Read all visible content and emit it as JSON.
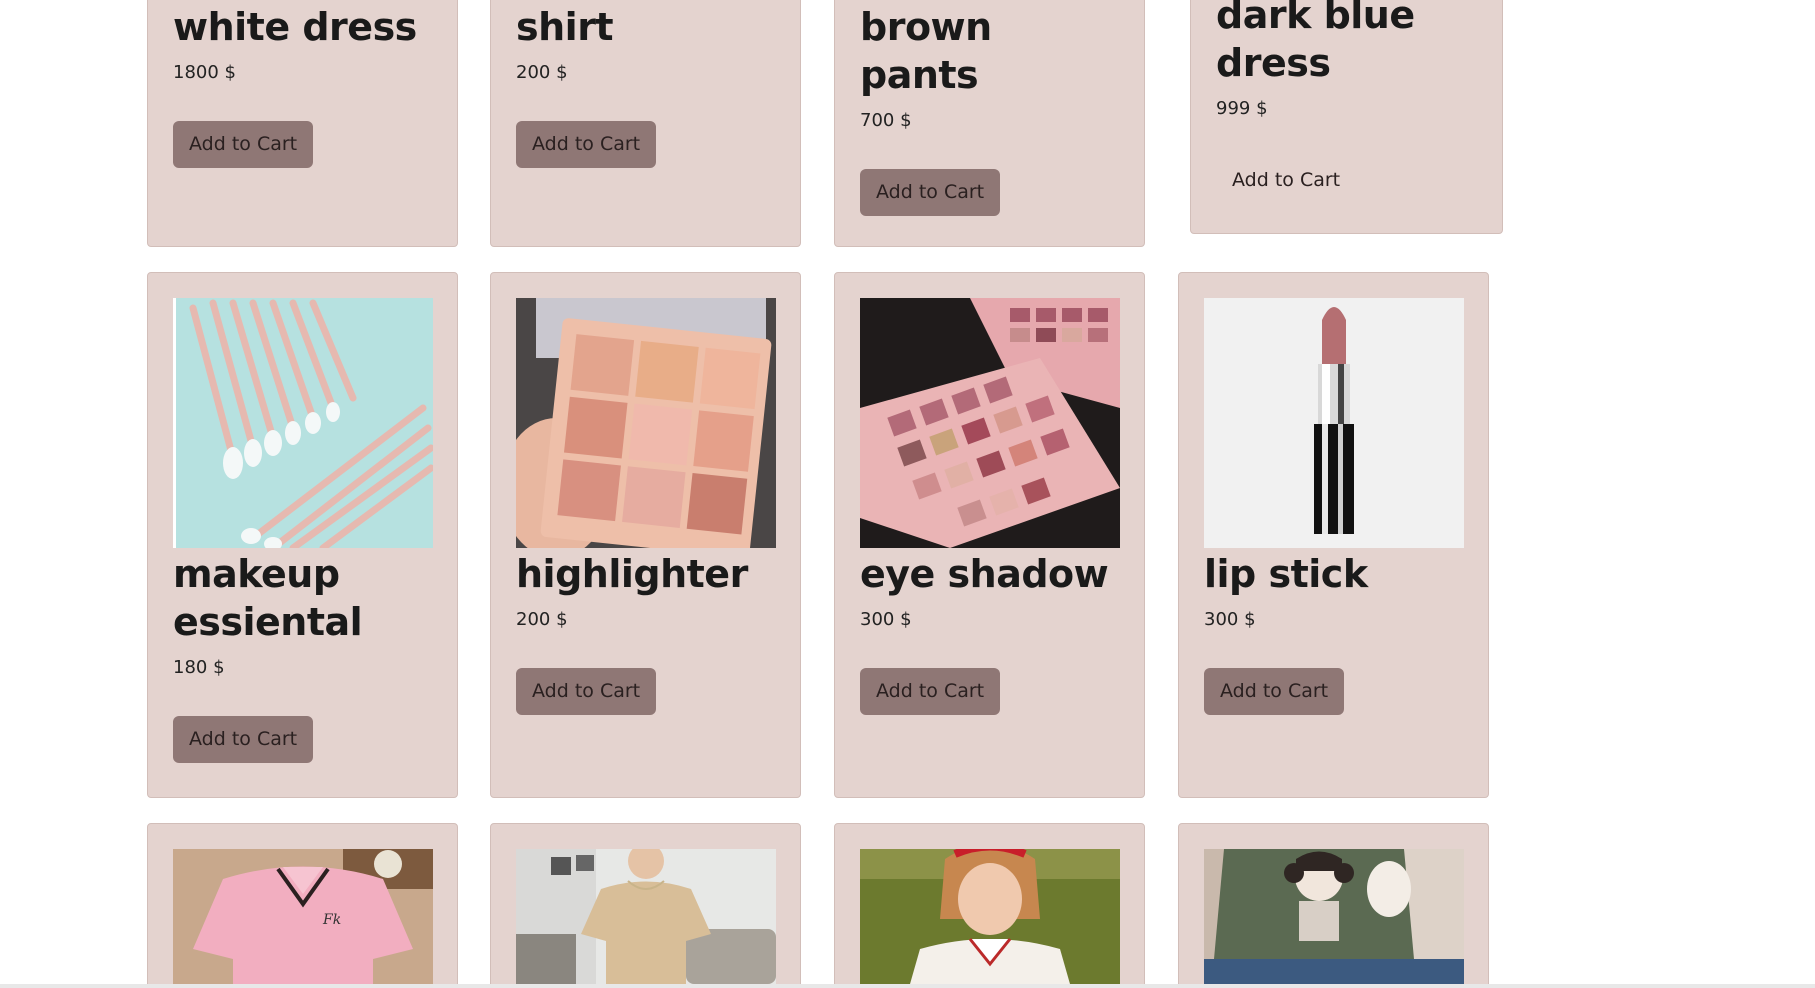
{
  "products_row1": [
    {
      "title": "white dress",
      "price": "1800 $",
      "button": "Add to Cart"
    },
    {
      "title": "shirt",
      "price": "200 $",
      "button": "Add to Cart"
    },
    {
      "title": "brown pants",
      "price": "700 $",
      "button": "Add to Cart"
    },
    {
      "title": "dark blue dress",
      "price": "999 $",
      "button": "Add to Cart"
    }
  ],
  "products_row2": [
    {
      "title": "makeup essiental",
      "price": "180 $",
      "button": "Add to Cart",
      "image": "makeup-brushes-image"
    },
    {
      "title": "highlighter",
      "price": "200 $",
      "button": "Add to Cart",
      "image": "eyeshadow-palette-image"
    },
    {
      "title": "eye shadow",
      "price": "300 $",
      "button": "Add to Cart",
      "image": "eyeshadow-palette-image"
    },
    {
      "title": "lip stick",
      "price": "300 $",
      "button": "Add to Cart",
      "image": "lipstick-image"
    }
  ],
  "products_row3": [
    {
      "image": "pink-polo-dress-image"
    },
    {
      "image": "kids-tshirt-image"
    },
    {
      "image": "girl-polo-image"
    },
    {
      "image": "green-sweater-image"
    }
  ],
  "colors": {
    "card_bg": "#e4d3cf",
    "button_bg": "#8f7775"
  }
}
